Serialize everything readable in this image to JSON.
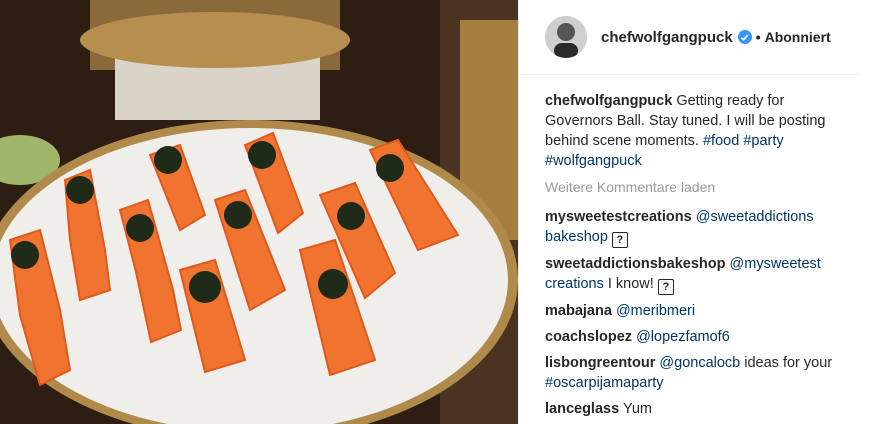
{
  "header": {
    "username": "chefwolfgangpuck",
    "separator": "•",
    "follow_label": "Abonniert",
    "verified_icon": "verified-badge-icon",
    "accent": "#3897f0"
  },
  "caption": {
    "username": "chefwolfgangpuck",
    "text": "Getting ready for Governors Ball. Stay tuned. I will be posting behind scene moments.",
    "hashtags": [
      "#food",
      "#party",
      "#wolfgangpuck"
    ]
  },
  "load_more": "Weitere Kommentare laden",
  "comments": [
    {
      "user": "mysweetestcreations",
      "parts": [
        {
          "kind": "mention",
          "text": "@sweetaddictions"
        },
        {
          "kind": "mention",
          "text": "bakeshop"
        }
      ],
      "emoji": "?"
    },
    {
      "user": "sweetaddictionsbakeshop",
      "parts": [
        {
          "kind": "mention",
          "text": "@mysweetest"
        },
        {
          "kind": "mention",
          "text": "creations"
        },
        {
          "kind": "text",
          "text": "I know!"
        }
      ],
      "emoji": "?"
    },
    {
      "user": "mabajana",
      "parts": [
        {
          "kind": "mention",
          "text": "@meribmeri"
        }
      ]
    },
    {
      "user": "coachslopez",
      "parts": [
        {
          "kind": "mention",
          "text": "@lopezfamof6"
        }
      ]
    },
    {
      "user": "lisbongreentour",
      "parts": [
        {
          "kind": "mention",
          "text": "@goncalocb"
        },
        {
          "kind": "text",
          "text": "ideas for your"
        },
        {
          "kind": "mention",
          "text": "#oscarpijamaparty"
        }
      ]
    },
    {
      "user": "lanceglass",
      "parts": [
        {
          "kind": "text",
          "text": "Yum"
        }
      ]
    }
  ],
  "colors": {
    "link": "#003569",
    "muted": "#999999",
    "text": "#262626"
  }
}
